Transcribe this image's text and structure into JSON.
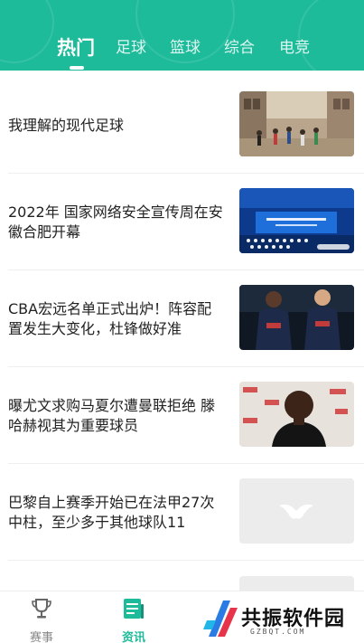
{
  "header": {
    "tabs": [
      {
        "label": "热门",
        "active": true
      },
      {
        "label": "足球",
        "active": false
      },
      {
        "label": "篮球",
        "active": false
      },
      {
        "label": "综合",
        "active": false
      },
      {
        "label": "电竞",
        "active": false
      }
    ]
  },
  "news": [
    {
      "title": "我理解的现代足球",
      "image": "street-football-photo"
    },
    {
      "title": "2022年 国家网络安全宣传周在安徽合肥开幕",
      "image": "conference-hall-photo"
    },
    {
      "title": "CBA宏远名单正式出炉！阵容配置发生大变化，杜锋做好准",
      "image": "basketball-players-photo"
    },
    {
      "title": "曝尤文求购马夏尔遭曼联拒绝 滕哈赫视其为重要球员",
      "image": "footballer-portrait-photo"
    },
    {
      "title": "巴黎自上赛季开始已在法甲27次中柱，至少多于其他球队11",
      "image": "image-placeholder"
    }
  ],
  "bottom_nav": [
    {
      "label": "赛事",
      "icon": "trophy-icon",
      "active": false
    },
    {
      "label": "资讯",
      "icon": "news-icon",
      "active": true
    }
  ],
  "watermark": {
    "name": "共振软件园",
    "url": "GZBQT.COM"
  },
  "colors": {
    "accent": "#1dbb9a",
    "text": "#222222",
    "muted": "#888888"
  }
}
